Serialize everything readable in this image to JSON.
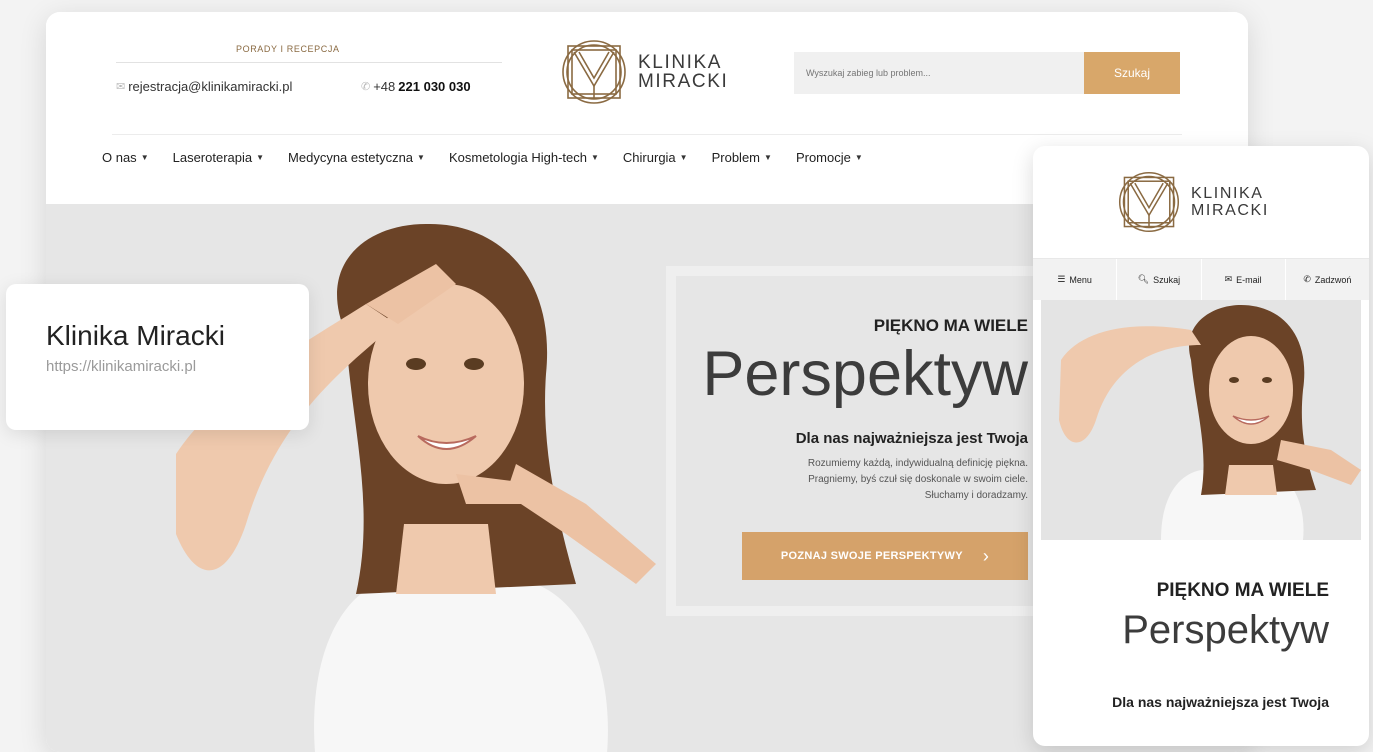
{
  "desktop": {
    "contact": {
      "label": "PORADY I RECEPCJA",
      "email": "rejestracja@klinikamiracki.pl",
      "phone_prefix": "+48",
      "phone_number": "221 030 030"
    },
    "logo": {
      "line1": "KLINIKA",
      "line2": "MIRACKI"
    },
    "search": {
      "placeholder": "Wyszukaj zabieg lub problem...",
      "button_label": "Szukaj"
    },
    "nav": {
      "items": [
        {
          "label": "O nas"
        },
        {
          "label": "Laseroterapia"
        },
        {
          "label": "Medycyna estetyczna"
        },
        {
          "label": "Kosmetologia High-tech"
        },
        {
          "label": "Chirurgia"
        },
        {
          "label": "Problem"
        },
        {
          "label": "Promocje"
        }
      ]
    },
    "hero": {
      "tagline": "PIĘKNO MA WIELE",
      "heading": "Perspektyw",
      "subheading": "Dla nas najważniejsza jest Twoja",
      "desc_line1": "Rozumiemy każdą, indywidualną definicję piękna.",
      "desc_line2": "Pragniemy, byś czuł się doskonale w swoim ciele.",
      "desc_line3": "Słuchamy i doradzamy.",
      "cta_label": "POZNAJ SWOJE PERSPEKTYWY",
      "cta_arrow": "›"
    }
  },
  "card": {
    "title": "Klinika Miracki",
    "url": "https://klinikamiracki.pl"
  },
  "mobile": {
    "logo": {
      "line1": "KLINIKA",
      "line2": "MIRACKI"
    },
    "bar": {
      "menu": "Menu",
      "search": "Szukaj",
      "email": "E-mail",
      "call": "Zadzwoń"
    },
    "hero": {
      "tagline": "PIĘKNO MA WIELE",
      "heading": "Perspektyw",
      "subheading": "Dla nas najważniejsza jest Twoja"
    }
  },
  "colors": {
    "accent": "#d5a26a",
    "hero_bg": "#e6e6e6",
    "logo": "#8a6a42"
  }
}
